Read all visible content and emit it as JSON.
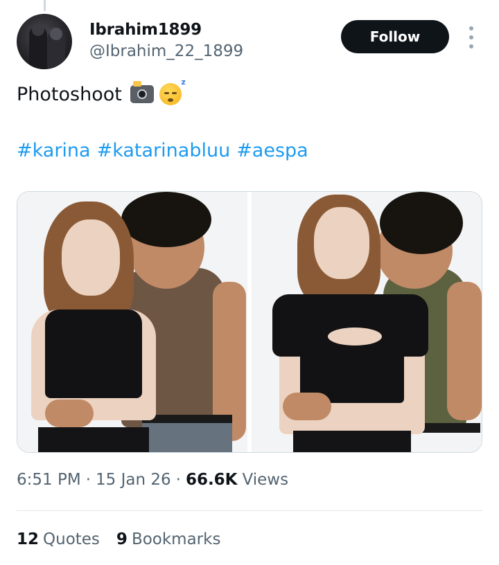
{
  "user": {
    "display_name": "Ibrahim1899",
    "handle": "@Ibrahim_22_1899",
    "avatar": "avatar-photo-two-people-dark"
  },
  "follow_button": {
    "label": "Follow"
  },
  "more_icon": "more-vertical-icon",
  "tweet": {
    "text": "Photoshoot",
    "emojis": [
      "camera-with-flash",
      "sleeping-face"
    ],
    "hashtags": [
      "#karina",
      "#katarinabluu",
      "#aespa"
    ]
  },
  "media": {
    "photos": [
      {
        "description_icon": "photo-1"
      },
      {
        "description_icon": "photo-2"
      }
    ]
  },
  "meta": {
    "time": "6:51 PM",
    "separator": "·",
    "date": "15 Jan 26",
    "views_count": "66.6K",
    "views_label": "Views"
  },
  "stats": {
    "quotes_count": "12",
    "quotes_label": "Quotes",
    "bookmarks_count": "9",
    "bookmarks_label": "Bookmarks"
  },
  "colors": {
    "link": "#1d9bf0",
    "text_primary": "#0f1419",
    "text_secondary": "#536471",
    "button_bg": "#0f1419"
  }
}
